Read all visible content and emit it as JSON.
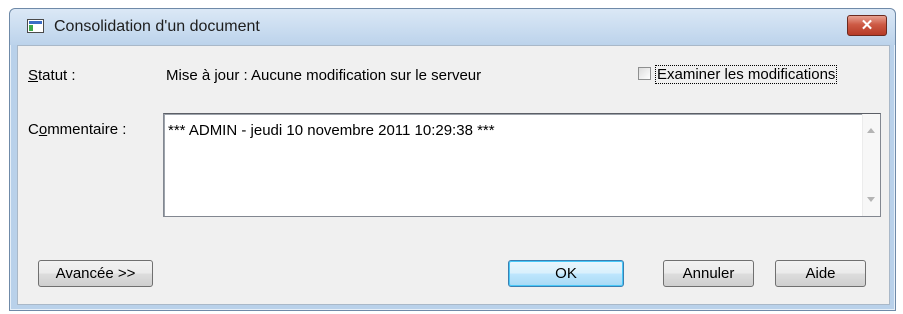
{
  "window": {
    "title": "Consolidation d'un document",
    "close_glyph": "✕"
  },
  "status": {
    "label": "Statut :",
    "label_accesskey": "S",
    "label_rest": "tatut :",
    "value": "Mise à jour : Aucune modification sur le serveur"
  },
  "review_checkbox": {
    "label": "Examiner les modifications",
    "accesskey": "E",
    "label_rest": "xaminer les modifications",
    "checked": false
  },
  "comment": {
    "label": "Commentaire :",
    "label_first": "C",
    "label_accesskey": "o",
    "label_rest": "mmentaire :",
    "value": "*** ADMIN - jeudi 10 novembre 2011 10:29:38 ***"
  },
  "buttons": {
    "advanced": "Avancée >>",
    "ok": "OK",
    "cancel": "Annuler",
    "help": "Aide"
  },
  "icons": {
    "app": "document-window-icon",
    "close": "close-icon",
    "scroll_up": "scroll-up-arrow-icon",
    "scroll_down": "scroll-down-arrow-icon"
  },
  "colors": {
    "close_button": "#c9513d",
    "frame": "#b9d1ea",
    "default_button_border": "#3c7fb1"
  }
}
